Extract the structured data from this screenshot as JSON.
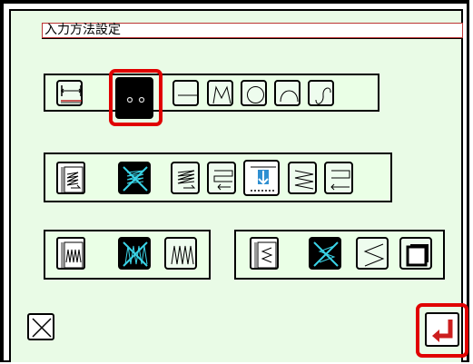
{
  "window": {
    "title": "入力方法設定"
  },
  "colors": {
    "panel_bg": "#e9fbe6",
    "selection_ring": "#e00000",
    "enter_arrow": "#cc1e1e",
    "stitch_blue": "#2f8fd1",
    "cross_cyan": "#3ad3e6"
  },
  "input_method_row": {
    "selected": "two-point-icon",
    "icons": [
      "measure-width-icon",
      "two-point-icon",
      "straight-line-icon",
      "zigzag-icon",
      "circle-icon",
      "arc-icon",
      "curve-icon"
    ]
  },
  "fill_row": {
    "icons": [
      "fill-pattern-page-icon",
      "no-fill-icon",
      "fill-stitch-icon",
      "fill-rectangle-icon",
      "fill-start-down-icon",
      "fill-diagonal-icon",
      "fill-turn-icon"
    ]
  },
  "zigzag_group": {
    "icons": [
      "zigzag-page-icon",
      "zigzag-none-icon",
      "zigzag-stitch-icon"
    ]
  },
  "edge_group": {
    "icons": [
      "edge-page-icon",
      "edge-none-icon",
      "edge-stitch-icon",
      "frame-shadow-icon"
    ]
  },
  "bottom": {
    "cancel_icon": "close-icon",
    "enter_icon": "enter-icon"
  }
}
